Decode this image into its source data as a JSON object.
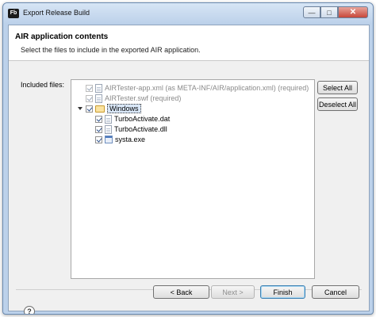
{
  "window": {
    "title": "Export Release Build",
    "app_icon_text": "Fb"
  },
  "header": {
    "title": "AIR application contents",
    "description": "Select the files to include in the exported AIR application."
  },
  "files_label": "Included files:",
  "tree": [
    {
      "label": "AIRTester-app.xml (as META-INF/AIR/application.xml) (required)",
      "checked": true,
      "disabled": true,
      "icon": "file-icon"
    },
    {
      "label": "AIRTester.swf (required)",
      "checked": true,
      "disabled": true,
      "icon": "file-icon"
    },
    {
      "label": "Windows",
      "checked": true,
      "expanded": true,
      "selected": true,
      "icon": "folder-icon"
    },
    {
      "label": "TurboActivate.dat",
      "checked": true,
      "icon": "file-icon"
    },
    {
      "label": "TurboActivate.dll",
      "checked": true,
      "icon": "file-icon"
    },
    {
      "label": "systa.exe",
      "checked": true,
      "icon": "exe-icon"
    }
  ],
  "buttons": {
    "select_all": "Select All",
    "deselect_all": "Deselect All",
    "back": "< Back",
    "next": "Next >",
    "finish": "Finish",
    "cancel": "Cancel",
    "help": "?"
  }
}
